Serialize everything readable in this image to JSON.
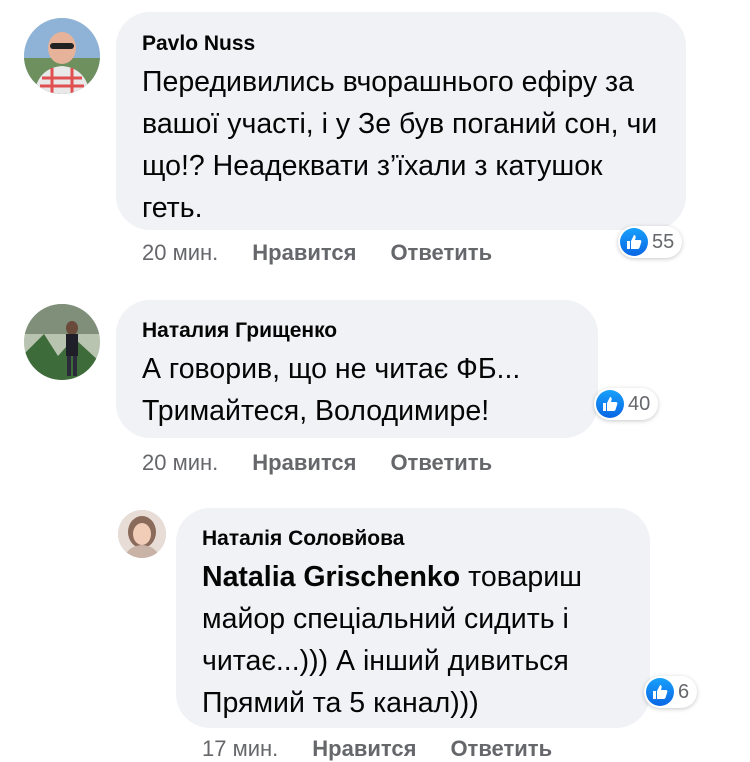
{
  "colors": {
    "bubble_bg": "#f0f2f5",
    "meta_text": "#65676b",
    "like_blue": "#1877f2"
  },
  "comments": [
    {
      "author": "Pavlo Nuss",
      "text": "Передивились вчорашнього ефіру за вашої участі, і у Зе був поганий сон, чи що!? Неадеквати з’їхали з катушок геть.",
      "time": "20 мин.",
      "like_label": "Нравится",
      "reply_label": "Ответить",
      "reaction_icon": "like-icon",
      "reaction_count": "55"
    },
    {
      "author": "Наталия Грищенко",
      "text": "А говорив, що не читає ФБ... Тримайтеся, Володимире!",
      "time": "20 мин.",
      "like_label": "Нравится",
      "reply_label": "Ответить",
      "reaction_icon": "like-icon",
      "reaction_count": "40"
    },
    {
      "author": "Наталія Соловйова",
      "mention": "Natalia Grischenko",
      "text": " товариш майор спеціальний сидить і читає...))) А інший дивиться Прямий та 5 канал)))",
      "time": "17 мин.",
      "like_label": "Нравится",
      "reply_label": "Ответить",
      "reaction_icon": "like-icon",
      "reaction_count": "6"
    }
  ]
}
